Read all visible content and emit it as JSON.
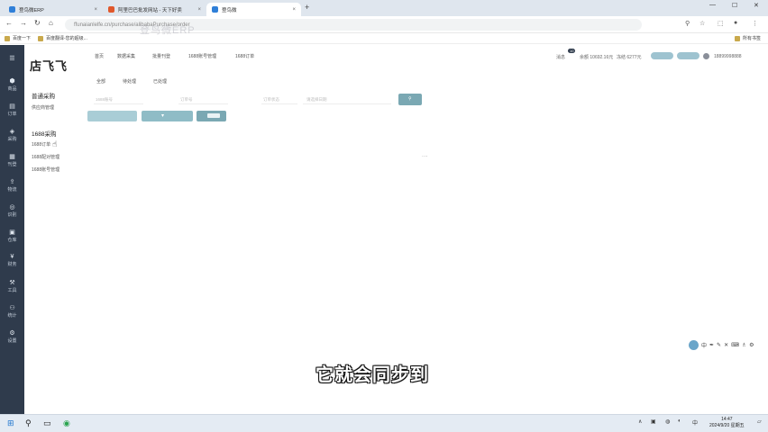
{
  "browser": {
    "tabs": [
      {
        "title": "登鸟微ERP",
        "active": false
      },
      {
        "title": "阿里巴巴批发网站 - 天下好卖",
        "active": false
      },
      {
        "title": "登鸟微",
        "active": true
      }
    ],
    "url": "ffunaianlelfe.cn/purchase/alibabaPurchase/order",
    "bookmarks": [
      "百度一下",
      "百度翻译-您的超级..."
    ],
    "bookmarks_right": "所有书签"
  },
  "watermark": "登鸟微ERP",
  "left_nav": {
    "items": [
      {
        "icon": "商",
        "label": "商品"
      },
      {
        "icon": "订",
        "label": "订单"
      },
      {
        "icon": "采",
        "label": "采购"
      },
      {
        "icon": "刊",
        "label": "刊登"
      },
      {
        "icon": "物",
        "label": "物流"
      },
      {
        "icon": "识",
        "label": "识别"
      },
      {
        "icon": "仓",
        "label": "仓库"
      },
      {
        "icon": "财",
        "label": "财务"
      },
      {
        "icon": "工",
        "label": "工具"
      },
      {
        "icon": "统",
        "label": "统计"
      },
      {
        "icon": "设",
        "label": "设置"
      }
    ]
  },
  "logo": "店飞飞",
  "top_nav": [
    "首页",
    "数据采集",
    "批量刊登",
    "1688账号管理",
    "1688订单"
  ],
  "account": {
    "balance": "余额 10692.16元",
    "frozen": "冻结 6277元",
    "user": "18899998888",
    "badge": "10"
  },
  "sidebar": {
    "section1_title": "普通采购",
    "section1_items": [
      "供应商管理"
    ],
    "section2_title": "1688采购",
    "section2_items": [
      "1688订单",
      "1688配对管理",
      "1688账号管理"
    ]
  },
  "subtabs": [
    "全部",
    "待处理",
    "已处理"
  ],
  "filters": {
    "placeholders": [
      "1688账号",
      "订单号",
      "订单状态",
      "请选择日期"
    ]
  },
  "caption": "它就会同步到",
  "float_tools": [
    "中",
    "✒",
    "⌨",
    "⚙"
  ],
  "taskbar": {
    "time": "14:47",
    "date": "2024/9/20 星期五"
  }
}
